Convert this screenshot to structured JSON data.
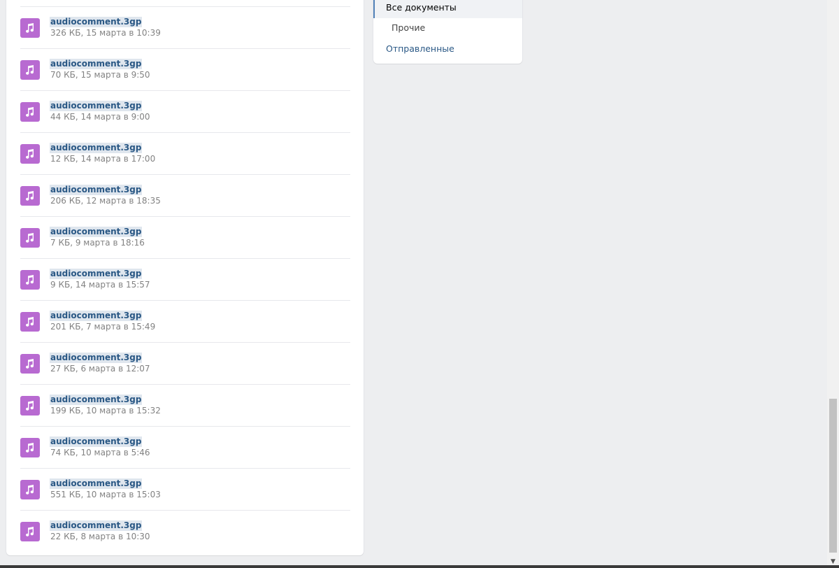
{
  "documents": [
    {
      "name": "audiocomment.3gp",
      "meta": "326 КБ, 15 марта в 10:39",
      "icon": "music-note-icon"
    },
    {
      "name": "audiocomment.3gp",
      "meta": "70 КБ, 15 марта в 9:50",
      "icon": "music-note-icon"
    },
    {
      "name": "audiocomment.3gp",
      "meta": "44 КБ, 14 марта в 9:00",
      "icon": "music-note-icon"
    },
    {
      "name": "audiocomment.3gp",
      "meta": "12 КБ, 14 марта в 17:00",
      "icon": "music-note-icon"
    },
    {
      "name": "audiocomment.3gp",
      "meta": "206 КБ, 12 марта в 18:35",
      "icon": "music-note-icon"
    },
    {
      "name": "audiocomment.3gp",
      "meta": "7 КБ, 9 марта в 18:16",
      "icon": "music-note-icon"
    },
    {
      "name": "audiocomment.3gp",
      "meta": "9 КБ, 14 марта в 15:57",
      "icon": "music-note-icon"
    },
    {
      "name": "audiocomment.3gp",
      "meta": "201 КБ, 7 марта в 15:49",
      "icon": "music-note-icon"
    },
    {
      "name": "audiocomment.3gp",
      "meta": "27 КБ, 6 марта в 12:07",
      "icon": "music-note-icon"
    },
    {
      "name": "audiocomment.3gp",
      "meta": "199 КБ, 10 марта в 15:32",
      "icon": "music-note-icon"
    },
    {
      "name": "audiocomment.3gp",
      "meta": "74 КБ, 10 марта в 5:46",
      "icon": "music-note-icon"
    },
    {
      "name": "audiocomment.3gp",
      "meta": "551 КБ, 10 марта в 15:03",
      "icon": "music-note-icon"
    },
    {
      "name": "audiocomment.3gp",
      "meta": "22 КБ, 8 марта в 10:30",
      "icon": "music-note-icon"
    }
  ],
  "menu": {
    "all_documents": "Все документы",
    "other": "Прочие",
    "sent": "Отправленные"
  },
  "colors": {
    "icon_bg": "#b86ad1",
    "link": "#2a5885",
    "active_border": "#5181b8",
    "page_bg": "#edeef0"
  },
  "scrollbar": {
    "down_arrow_icon": "triangle-down-icon"
  }
}
